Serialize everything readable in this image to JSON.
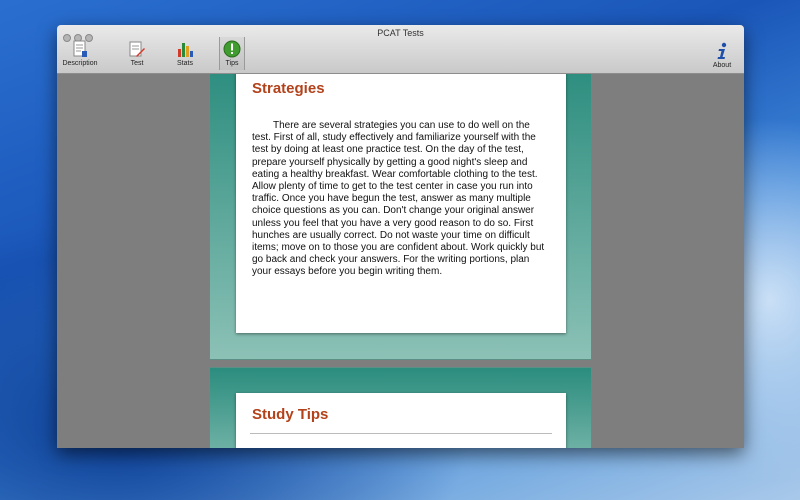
{
  "window": {
    "title": "PCAT Tests"
  },
  "toolbar": {
    "items": [
      {
        "label": "Description",
        "icon": "description-document-icon"
      },
      {
        "label": "Test",
        "icon": "test-pencil-icon"
      },
      {
        "label": "Stats",
        "icon": "stats-bar-chart-icon"
      },
      {
        "label": "Tips",
        "icon": "tips-exclamation-icon",
        "selected": true
      }
    ],
    "about_label": "About"
  },
  "sections": [
    {
      "heading": "Strategies",
      "body": "There are several strategies you can use to do well on the test. First of all, study effectively and familiarize yourself with the test by doing at least one practice test. On the day of the test, prepare yourself physically by getting a good night's sleep and eating a healthy breakfast. Wear comfortable clothing to the test. Allow plenty of time to get to the test center in case you run into traffic. Once you have begun the test, answer as many multiple choice questions as you can. Don't change your original answer unless you feel that you have a very good reason to do so. First hunches are usually correct. Do not waste your time on difficult items; move on to those you are confident about. Work quickly but go back and check your answers. For the writing portions, plan your essays before you begin writing them."
    },
    {
      "heading": "Study Tips"
    }
  ],
  "colors": {
    "heading": "#b3421b",
    "teal": "#2b8d7e"
  }
}
